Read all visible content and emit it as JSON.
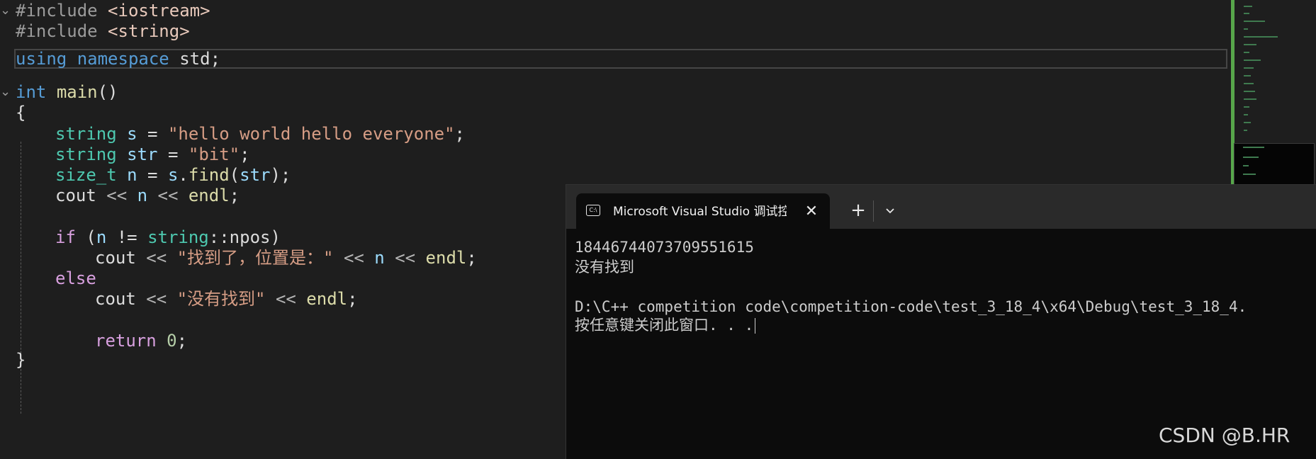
{
  "editor": {
    "include1": {
      "directive": "#include",
      "header": "<iostream>"
    },
    "include2": {
      "directive": "#include",
      "header": "<string>"
    },
    "using_line": {
      "kw1": "using",
      "kw2": "namespace",
      "ns": "std",
      "semi": ";"
    },
    "main_sig": {
      "type": "int",
      "name": "main",
      "parens": "()"
    },
    "open_brace": "{",
    "line_s": {
      "type": "string",
      "var": "s",
      "eq": " = ",
      "value": "\"hello world hello everyone\"",
      "semi": ";"
    },
    "line_str": {
      "type": "string",
      "var": "str",
      "eq": " = ",
      "value": "\"bit\"",
      "semi": ";"
    },
    "line_find": {
      "type": "size_t",
      "var": "n",
      "eq": " = ",
      "obj": "s",
      "dot": ".",
      "fn": "find",
      "open": "(",
      "arg": "str",
      "close": ");"
    },
    "line_cout1": {
      "obj": "cout",
      "op1": " << ",
      "var": "n",
      "op2": " << ",
      "endl": "endl",
      "semi": ";"
    },
    "line_if": {
      "kw": "if",
      "open": " (",
      "var": "n",
      "op": " != ",
      "type": "string",
      "scope": "::npos",
      "close": ")"
    },
    "line_cout2": {
      "obj": "cout",
      "op1": " << ",
      "value": "\"找到了，位置是：\"",
      "op2": " << ",
      "var": "n",
      "op3": " << ",
      "endl": "endl",
      "semi": ";"
    },
    "line_else": "else",
    "line_cout3": {
      "obj": "cout",
      "op1": " << ",
      "value": "\"没有找到\"",
      "op2": " << ",
      "endl": "endl",
      "semi": ";"
    },
    "line_return": {
      "kw": "return",
      "num": "0",
      "semi": ";"
    },
    "close_brace": "}"
  },
  "terminal": {
    "tab_icon": "C:\\",
    "tab_title": "Microsoft Visual Studio 调试控",
    "tab_close": "✕",
    "new_tab": "+",
    "output": [
      "18446744073709551615",
      "没有找到",
      "",
      "D:\\C++ competition code\\competition-code\\test_3_18_4\\x64\\Debug\\test_3_18_4.",
      "按任意键关闭此窗口. . ."
    ]
  },
  "watermark": "CSDN @B.HR",
  "icons": {
    "terminal": "terminal-app-icon",
    "close": "close-icon",
    "plus": "plus-icon",
    "dropdown": "chevron-down-icon"
  },
  "colors": {
    "keyword": "#569cd6",
    "control_keyword": "#d8a0df",
    "type": "#4ec9b0",
    "function": "#dcdcaa",
    "string": "#d69d85",
    "number": "#b5cea8",
    "editor_bg": "#1e1e1e",
    "terminal_bg": "#0c0c0c"
  }
}
